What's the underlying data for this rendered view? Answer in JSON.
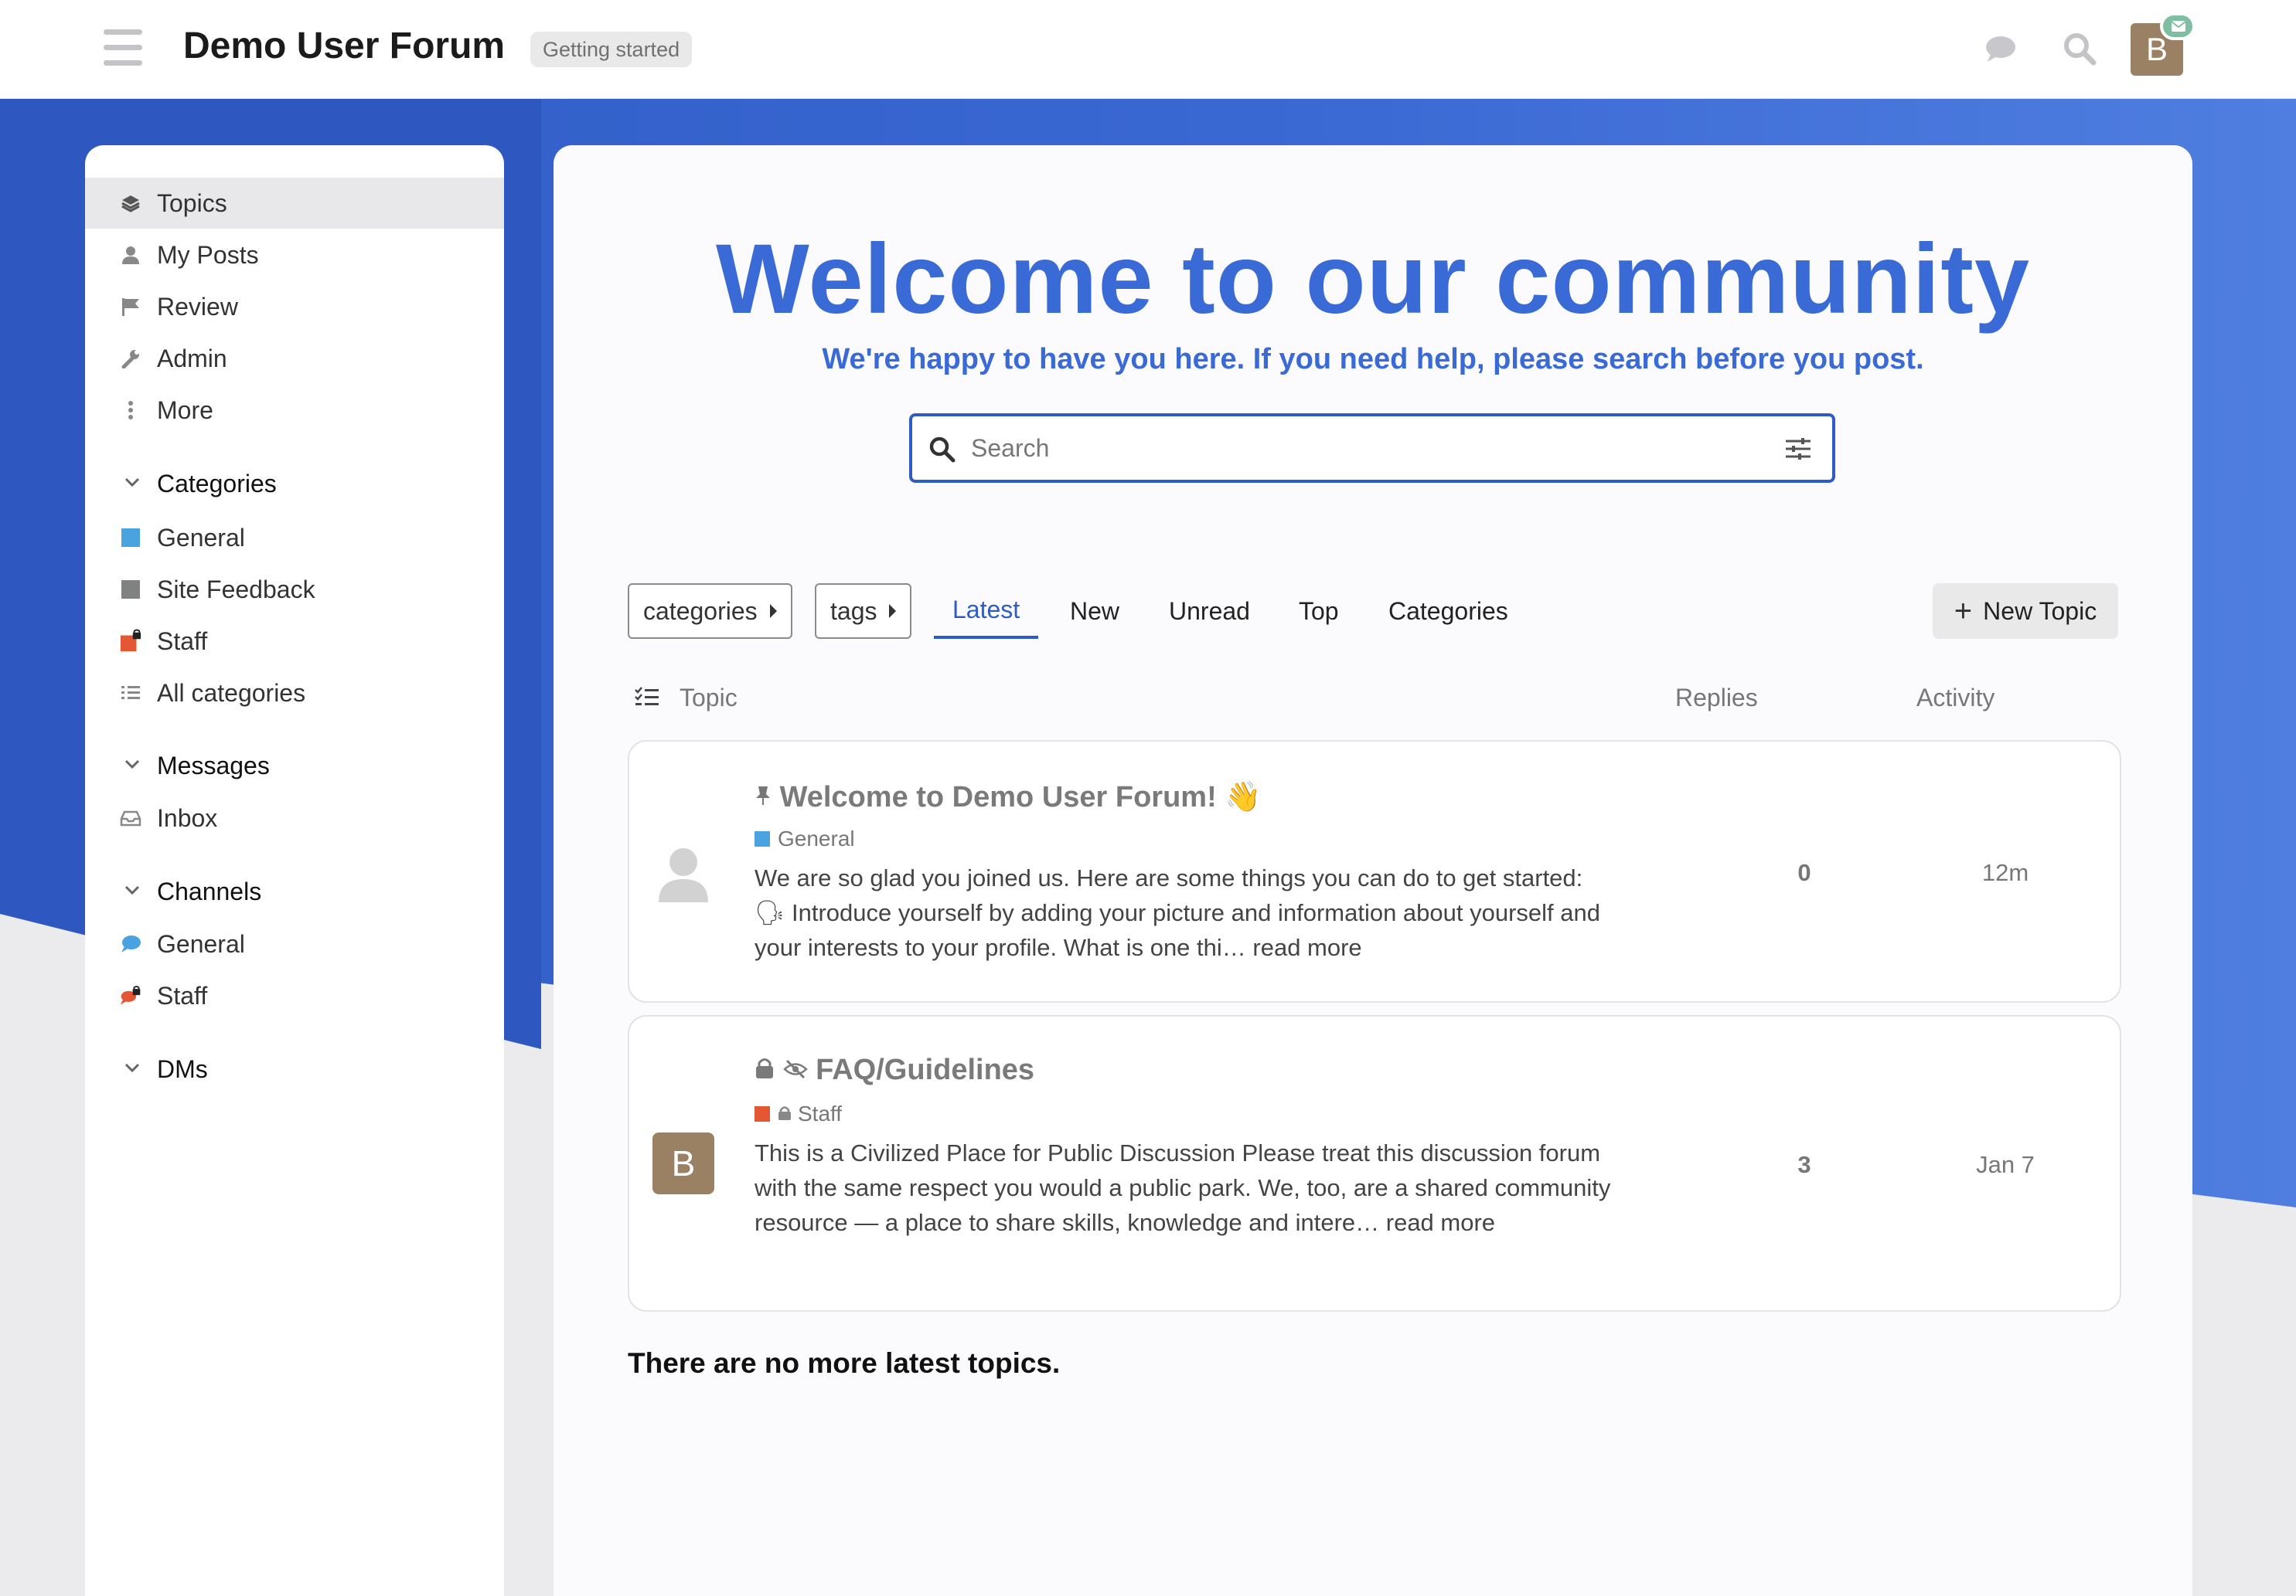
{
  "header": {
    "site_title": "Demo User Forum",
    "badge": "Getting started",
    "avatar_letter": "B",
    "icons": [
      "menu-icon",
      "chat-bubble-icon",
      "search-icon",
      "mail-icon"
    ]
  },
  "sidebar": {
    "items": [
      {
        "label": "Topics",
        "icon": "layers-icon"
      },
      {
        "label": "My Posts",
        "icon": "user-icon"
      },
      {
        "label": "Review",
        "icon": "flag-icon"
      },
      {
        "label": "Admin",
        "icon": "wrench-icon"
      },
      {
        "label": "More",
        "icon": "ellipsis-vertical-icon"
      }
    ],
    "categories": {
      "heading": "Categories",
      "items": [
        {
          "label": "General",
          "color": "#4aa3df"
        },
        {
          "label": "Site Feedback",
          "color": "#808281"
        },
        {
          "label": "Staff",
          "color": "#e45735"
        },
        {
          "label": "All categories"
        }
      ]
    },
    "messages": {
      "heading": "Messages",
      "items": [
        {
          "label": "Inbox"
        }
      ]
    },
    "channels": {
      "heading": "Channels",
      "items": [
        {
          "label": "General",
          "color": "#4aa3df"
        },
        {
          "label": "Staff",
          "color": "#e45735"
        }
      ]
    },
    "dms": {
      "heading": "DMs"
    }
  },
  "hero": {
    "title": "Welcome to our community",
    "subtitle": "We're happy to have you here. If you need help, please search before you post.",
    "search_placeholder": "Search"
  },
  "nav": {
    "categories_dropdown": "categories",
    "tags_dropdown": "tags",
    "tabs": [
      "Latest",
      "New",
      "Unread",
      "Top",
      "Categories"
    ],
    "active_tab": "Latest",
    "new_topic": "New Topic"
  },
  "list": {
    "col_topic": "Topic",
    "col_replies": "Replies",
    "col_activity": "Activity",
    "topics": [
      {
        "title": "Welcome to Demo User Forum!",
        "emoji": "👋",
        "category": "General",
        "category_color": "#4aa3df",
        "excerpt_line1": "We are so glad you joined us. Here are some things you can do to get started:",
        "excerpt_emoji": "🗣",
        "excerpt_rest": " Introduce yourself by adding your picture and information about yourself and your interests to your profile. What is one thi… ",
        "read_more": "read more",
        "replies": "0",
        "activity": "12m"
      },
      {
        "title": "FAQ/Guidelines",
        "category": "Staff",
        "category_color": "#e45735",
        "avatar_letter": "B",
        "excerpt": "This is a Civilized Place for Public Discussion Please treat this discussion forum with the same respect you would a public park. We, too, are a shared community resource — a place to share skills, knowledge and intere… ",
        "read_more": "read more",
        "replies": "3",
        "activity": "Jan 7"
      }
    ],
    "footer": "There are no more latest topics."
  }
}
